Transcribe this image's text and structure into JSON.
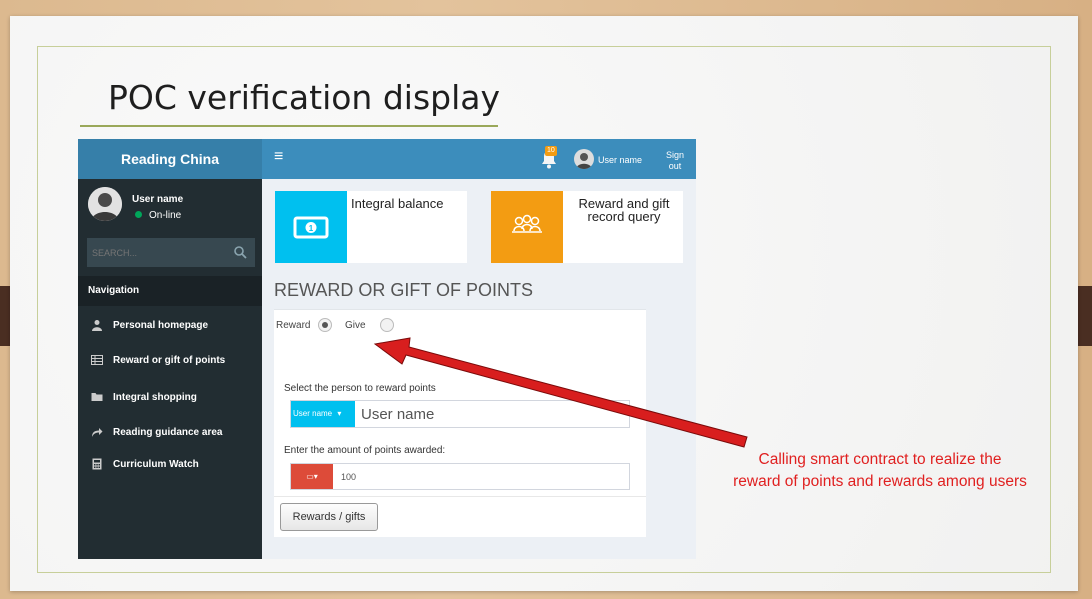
{
  "slide": {
    "title": "POC verification display",
    "annotation_line1": "Calling smart contract to realize the",
    "annotation_line2": "reward of points and rewards among users"
  },
  "header": {
    "brand": "Reading China",
    "menu_icon": "≡",
    "notification_count": "10",
    "user_name": "User name",
    "sign_out_line1": "Sign",
    "sign_out_line2": "out"
  },
  "sidebar": {
    "user_name": "User name",
    "status": "On-line",
    "search_placeholder": "SEARCH...",
    "nav_header": "Navigation",
    "items": [
      {
        "label": "Personal homepage",
        "icon": "user-icon"
      },
      {
        "label": "Reward or gift of points",
        "icon": "table-icon"
      },
      {
        "label": "Integral shopping",
        "icon": "folder-icon"
      },
      {
        "label": "Reading guidance area",
        "icon": "share-icon"
      },
      {
        "label": "Curriculum Watch",
        "icon": "calculator-icon"
      }
    ]
  },
  "info_boxes": [
    {
      "title": "Integral balance",
      "color": "#00c0ef",
      "icon": "money-icon"
    },
    {
      "title_line1": "Reward and gift",
      "title_line2": "record query",
      "color": "#f39c12",
      "icon": "people-icon"
    }
  ],
  "form": {
    "section_title": "REWARD OR GIFT OF POINTS",
    "radio_reward": "Reward",
    "radio_give": "Give",
    "selected": "Reward",
    "person_label": "Select the person to reward points",
    "person_addon": "User name",
    "person_value": "User name",
    "amount_label": "Enter the amount of points awarded:",
    "amount_value": "100",
    "submit_label": "Rewards / gifts"
  },
  "colors": {
    "header": "#3c8dbc",
    "sidebar": "#222d32",
    "arrow": "#e02020"
  }
}
